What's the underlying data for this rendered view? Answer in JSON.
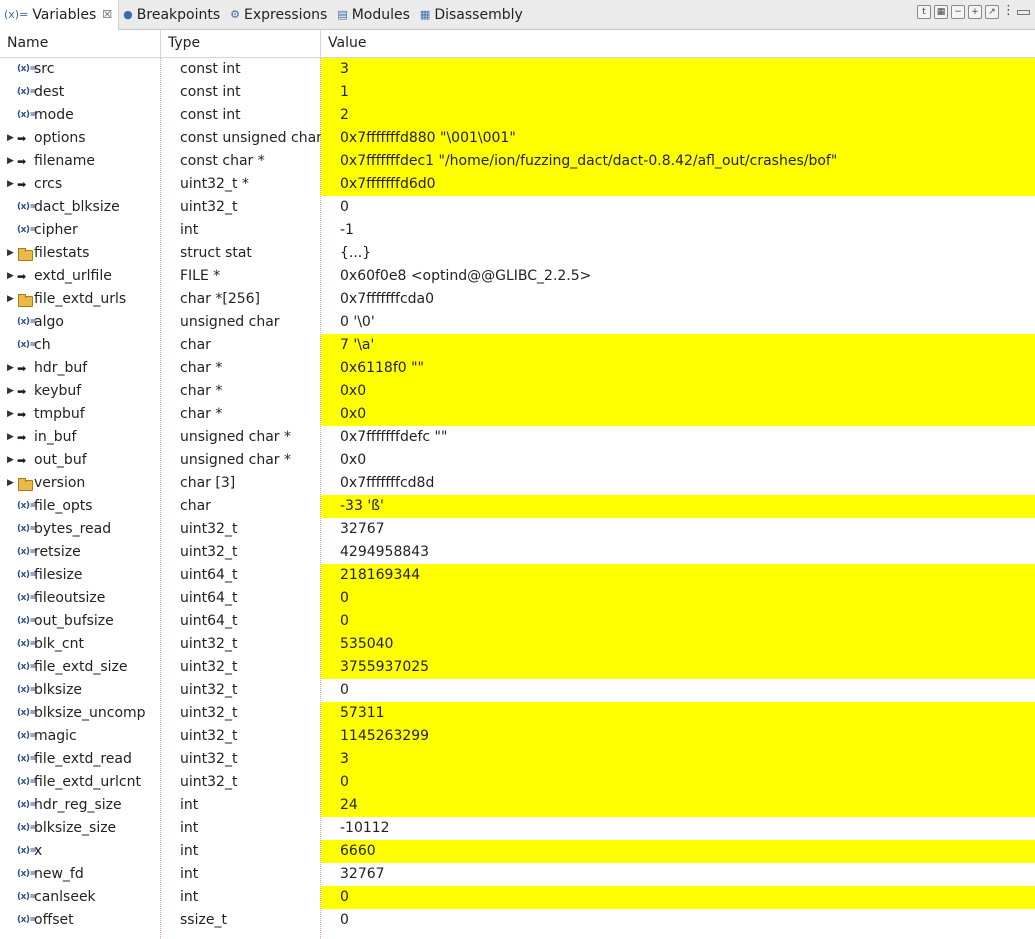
{
  "tabs": [
    {
      "label": "Variables",
      "icon": "(x)=",
      "active": true
    },
    {
      "label": "Breakpoints",
      "icon": "●"
    },
    {
      "label": "Expressions",
      "icon": "⚙"
    },
    {
      "label": "Modules",
      "icon": "▤"
    },
    {
      "label": "Disassembly",
      "icon": "▦"
    }
  ],
  "columns": {
    "name": "Name",
    "type": "Type",
    "value": "Value"
  },
  "icons": {
    "variable": "variable-icon",
    "pointer": "pointer-arrow-icon",
    "struct": "struct-folder-icon",
    "expand": "chevron-right-icon"
  },
  "highlight_color": "#ffff00",
  "rows": [
    {
      "name": "src",
      "type": "const int",
      "value": "3",
      "kind": "var",
      "expand": false,
      "hl": true
    },
    {
      "name": "dest",
      "type": "const int",
      "value": "1",
      "kind": "var",
      "expand": false,
      "hl": true
    },
    {
      "name": "mode",
      "type": "const int",
      "value": "2",
      "kind": "var",
      "expand": false,
      "hl": true
    },
    {
      "name": "options",
      "type": "const unsigned char *",
      "value": "0x7fffffffd880 \"\\001\\001\"",
      "kind": "ptr",
      "expand": true,
      "hl": true
    },
    {
      "name": "filename",
      "type": "const char *",
      "value": "0x7fffffffdec1 \"/home/ion/fuzzing_dact/dact-0.8.42/afl_out/crashes/bof\"",
      "kind": "ptr",
      "expand": true,
      "hl": true
    },
    {
      "name": "crcs",
      "type": "uint32_t *",
      "value": "0x7fffffffd6d0",
      "kind": "ptr",
      "expand": true,
      "hl": true
    },
    {
      "name": "dact_blksize",
      "type": "uint32_t",
      "value": "0",
      "kind": "var",
      "expand": false,
      "hl": false
    },
    {
      "name": "cipher",
      "type": "int",
      "value": "-1",
      "kind": "var",
      "expand": false,
      "hl": false
    },
    {
      "name": "filestats",
      "type": "struct stat",
      "value": "{...}",
      "kind": "struct",
      "expand": true,
      "hl": false
    },
    {
      "name": "extd_urlfile",
      "type": "FILE *",
      "value": "0x60f0e8 <optind@@GLIBC_2.2.5>",
      "kind": "ptr",
      "expand": true,
      "hl": false
    },
    {
      "name": "file_extd_urls",
      "type": "char *[256]",
      "value": "0x7fffffffcda0",
      "kind": "struct",
      "expand": true,
      "hl": false
    },
    {
      "name": "algo",
      "type": "unsigned char",
      "value": "0 '\\0'",
      "kind": "var",
      "expand": false,
      "hl": false
    },
    {
      "name": "ch",
      "type": "char",
      "value": "7 '\\a'",
      "kind": "var",
      "expand": false,
      "hl": true
    },
    {
      "name": "hdr_buf",
      "type": "char *",
      "value": "0x6118f0 \"\"",
      "kind": "ptr",
      "expand": true,
      "hl": true
    },
    {
      "name": "keybuf",
      "type": "char *",
      "value": "0x0",
      "kind": "ptr",
      "expand": true,
      "hl": true
    },
    {
      "name": "tmpbuf",
      "type": "char *",
      "value": "0x0",
      "kind": "ptr",
      "expand": true,
      "hl": true
    },
    {
      "name": "in_buf",
      "type": "unsigned char *",
      "value": "0x7fffffffdefc \"\"",
      "kind": "ptr",
      "expand": true,
      "hl": false
    },
    {
      "name": "out_buf",
      "type": "unsigned char *",
      "value": "0x0",
      "kind": "ptr",
      "expand": true,
      "hl": false
    },
    {
      "name": "version",
      "type": "char [3]",
      "value": "0x7fffffffcd8d",
      "kind": "struct",
      "expand": true,
      "hl": false
    },
    {
      "name": "file_opts",
      "type": "char",
      "value": "-33 'ß'",
      "kind": "var",
      "expand": false,
      "hl": true
    },
    {
      "name": "bytes_read",
      "type": "uint32_t",
      "value": "32767",
      "kind": "var",
      "expand": false,
      "hl": false
    },
    {
      "name": "retsize",
      "type": "uint32_t",
      "value": "4294958843",
      "kind": "var",
      "expand": false,
      "hl": false
    },
    {
      "name": "filesize",
      "type": "uint64_t",
      "value": "218169344",
      "kind": "var",
      "expand": false,
      "hl": true
    },
    {
      "name": "fileoutsize",
      "type": "uint64_t",
      "value": "0",
      "kind": "var",
      "expand": false,
      "hl": true
    },
    {
      "name": "out_bufsize",
      "type": "uint64_t",
      "value": "0",
      "kind": "var",
      "expand": false,
      "hl": true
    },
    {
      "name": "blk_cnt",
      "type": "uint32_t",
      "value": "535040",
      "kind": "var",
      "expand": false,
      "hl": true
    },
    {
      "name": "file_extd_size",
      "type": "uint32_t",
      "value": "3755937025",
      "kind": "var",
      "expand": false,
      "hl": true
    },
    {
      "name": "blksize",
      "type": "uint32_t",
      "value": "0",
      "kind": "var",
      "expand": false,
      "hl": false
    },
    {
      "name": "blksize_uncomp",
      "type": "uint32_t",
      "value": "57311",
      "kind": "var",
      "expand": false,
      "hl": true
    },
    {
      "name": "magic",
      "type": "uint32_t",
      "value": "1145263299",
      "kind": "var",
      "expand": false,
      "hl": true
    },
    {
      "name": "file_extd_read",
      "type": "uint32_t",
      "value": "3",
      "kind": "var",
      "expand": false,
      "hl": true
    },
    {
      "name": "file_extd_urlcnt",
      "type": "uint32_t",
      "value": "0",
      "kind": "var",
      "expand": false,
      "hl": true
    },
    {
      "name": "hdr_reg_size",
      "type": "int",
      "value": "24",
      "kind": "var",
      "expand": false,
      "hl": true
    },
    {
      "name": "blksize_size",
      "type": "int",
      "value": "-10112",
      "kind": "var",
      "expand": false,
      "hl": false
    },
    {
      "name": "x",
      "type": "int",
      "value": "6660",
      "kind": "var",
      "expand": false,
      "hl": true
    },
    {
      "name": "new_fd",
      "type": "int",
      "value": "32767",
      "kind": "var",
      "expand": false,
      "hl": false
    },
    {
      "name": "canlseek",
      "type": "int",
      "value": "0",
      "kind": "var",
      "expand": false,
      "hl": true
    },
    {
      "name": "offset",
      "type": "ssize_t",
      "value": "0",
      "kind": "var",
      "expand": false,
      "hl": false
    }
  ]
}
